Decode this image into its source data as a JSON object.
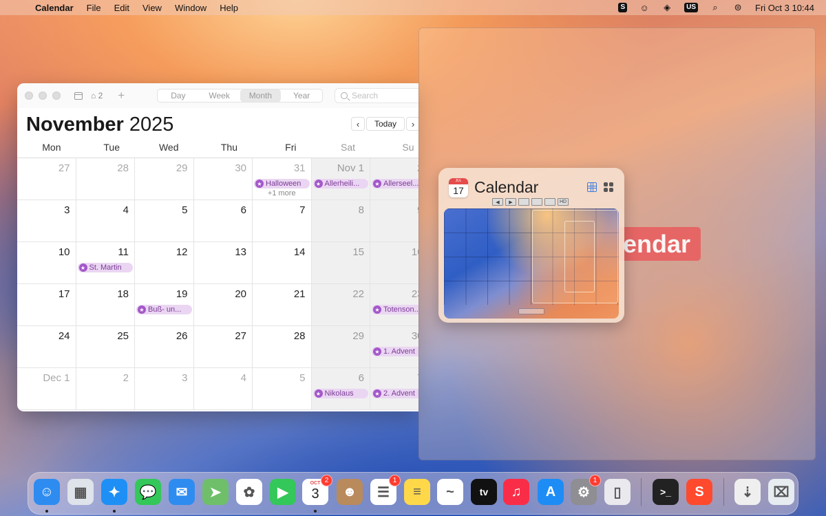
{
  "menubar": {
    "app_name": "Calendar",
    "menus": [
      "File",
      "Edit",
      "View",
      "Window",
      "Help"
    ],
    "keyboard_layout": "US",
    "clock": "Fri Oct 3  10:44"
  },
  "calendar_window": {
    "inbox_count": "2",
    "view_tabs": [
      "Day",
      "Week",
      "Month",
      "Year"
    ],
    "active_view": "Month",
    "search_placeholder": "Search",
    "month_name": "November",
    "year": "2025",
    "today_label": "Today",
    "weekdays": [
      "Mon",
      "Tue",
      "Wed",
      "Thu",
      "Fri",
      "Sat",
      "Su"
    ],
    "weeks": [
      [
        {
          "d": "27",
          "other": true
        },
        {
          "d": "28",
          "other": true
        },
        {
          "d": "29",
          "other": true
        },
        {
          "d": "30",
          "other": true
        },
        {
          "d": "31",
          "other": true,
          "event": "Halloween",
          "more": "+1 more"
        },
        {
          "d": "Nov 1",
          "event": "Allerheili..."
        },
        {
          "d": "2",
          "event": "Allerseel..."
        }
      ],
      [
        {
          "d": "3"
        },
        {
          "d": "4"
        },
        {
          "d": "5"
        },
        {
          "d": "6"
        },
        {
          "d": "7"
        },
        {
          "d": "8"
        },
        {
          "d": "9"
        }
      ],
      [
        {
          "d": "10"
        },
        {
          "d": "11",
          "event": "St. Martin"
        },
        {
          "d": "12"
        },
        {
          "d": "13"
        },
        {
          "d": "14"
        },
        {
          "d": "15"
        },
        {
          "d": "16"
        }
      ],
      [
        {
          "d": "17"
        },
        {
          "d": "18"
        },
        {
          "d": "19",
          "event": "Buß- un..."
        },
        {
          "d": "20"
        },
        {
          "d": "21"
        },
        {
          "d": "22"
        },
        {
          "d": "23",
          "event": "Totenson..."
        }
      ],
      [
        {
          "d": "24"
        },
        {
          "d": "25"
        },
        {
          "d": "26"
        },
        {
          "d": "27"
        },
        {
          "d": "28"
        },
        {
          "d": "29"
        },
        {
          "d": "30",
          "event": "1. Advent"
        }
      ],
      [
        {
          "d": "Dec 1",
          "other": true
        },
        {
          "d": "2",
          "other": true
        },
        {
          "d": "3",
          "other": true
        },
        {
          "d": "4",
          "other": true
        },
        {
          "d": "5",
          "other": true
        },
        {
          "d": "6",
          "other": true,
          "event": "Nikolaus"
        },
        {
          "d": "7",
          "other": true,
          "event": "2. Advent"
        }
      ]
    ]
  },
  "window_preview": {
    "app_icon_month": "JUL",
    "app_icon_day": "17",
    "title": "Calendar",
    "controls": [
      "◀",
      "▶",
      "",
      "",
      "",
      "HD"
    ]
  },
  "drag_label_text": "endar",
  "dock": {
    "calendar_icon_month": "OCT",
    "calendar_icon_day": "3",
    "items": [
      {
        "name": "finder",
        "color": "#2e8cf0"
      },
      {
        "name": "launchpad",
        "color": "#dfe3ea"
      },
      {
        "name": "safari",
        "color": "#1e90f5"
      },
      {
        "name": "messages",
        "color": "#34c759"
      },
      {
        "name": "mail",
        "color": "#2e8cf0"
      },
      {
        "name": "maps",
        "color": "#6fbf6a"
      },
      {
        "name": "photos",
        "color": "#ffffff"
      },
      {
        "name": "facetime",
        "color": "#34c759"
      },
      {
        "name": "calendar",
        "color": "#ffffff",
        "badge": "2"
      },
      {
        "name": "contacts",
        "color": "#b98a5c"
      },
      {
        "name": "reminders",
        "color": "#ffffff",
        "badge": "1"
      },
      {
        "name": "notes",
        "color": "#ffd84a"
      },
      {
        "name": "freeform",
        "color": "#ffffff"
      },
      {
        "name": "apple-tv",
        "color": "#111111"
      },
      {
        "name": "music",
        "color": "#fa2d48"
      },
      {
        "name": "app-store",
        "color": "#1e8cf5"
      },
      {
        "name": "system-settings",
        "color": "#8e8e93",
        "badge": "1"
      },
      {
        "name": "iphone-mirroring",
        "color": "#e9e9ee"
      },
      {
        "name": "terminal",
        "color": "#222222"
      },
      {
        "name": "s-app",
        "color": "#ff4a2e"
      },
      {
        "name": "downloads",
        "color": "#efefef"
      },
      {
        "name": "trash",
        "color": "#e6ecf0"
      }
    ]
  }
}
